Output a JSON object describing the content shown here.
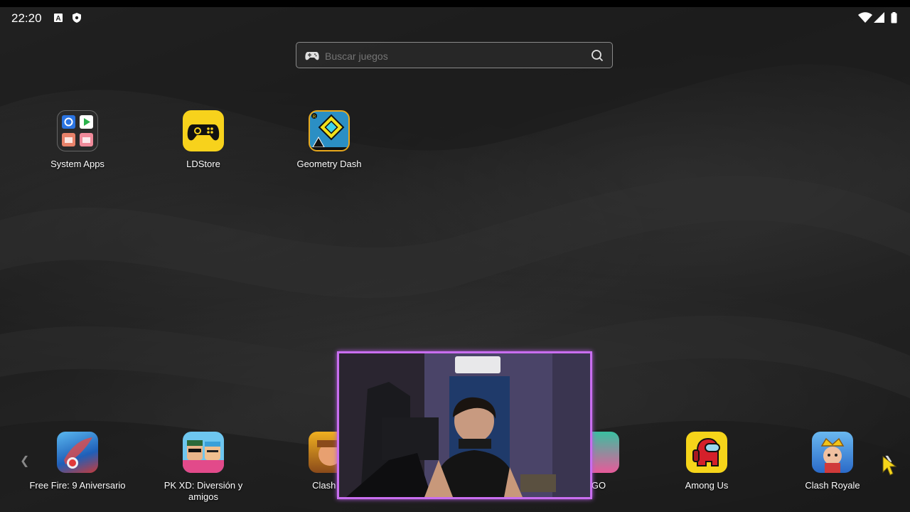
{
  "status_bar": {
    "time": "22:20",
    "left_icons": [
      "font-a-icon",
      "shield-icon"
    ],
    "right_icons": [
      "wifi-icon",
      "signal-icon",
      "battery-icon"
    ]
  },
  "search": {
    "placeholder": "Buscar juegos",
    "left_icon": "gamepad-icon",
    "right_icon": "search-icon"
  },
  "desktop_apps": [
    {
      "label": "System Apps",
      "icon": "folder-icon"
    },
    {
      "label": "LDStore",
      "icon": "ldstore-icon",
      "color": "#f7d21c"
    },
    {
      "label": "Geometry Dash",
      "icon": "geometry-dash-icon",
      "color": "#e8a81c"
    }
  ],
  "dock": {
    "left_arrow": "chevron-left-icon",
    "right_arrow": "chevron-right-icon",
    "apps": [
      {
        "label": "Free Fire: 9 Aniversario",
        "icon": "free-fire-icon"
      },
      {
        "label": "PK XD: Diversión y amigos",
        "icon": "pk-xd-icon"
      },
      {
        "label": "Clash of",
        "icon": "clash-of-clans-icon"
      },
      {
        "label": "GO",
        "icon": "go-app-icon"
      },
      {
        "label": "Among Us",
        "icon": "among-us-icon"
      },
      {
        "label": "Clash Royale",
        "icon": "clash-royale-icon"
      }
    ]
  },
  "webcam_overlay": {
    "border_color": "#c96ef0"
  }
}
